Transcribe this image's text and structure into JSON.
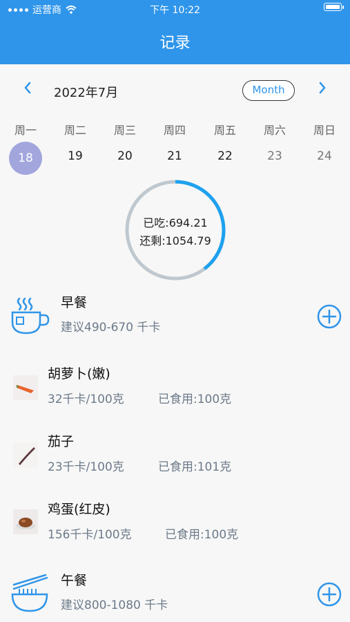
{
  "status_bar": {
    "carrier": "运营商",
    "time": "下午 10:22"
  },
  "header": {
    "title": "记录"
  },
  "calendar": {
    "month_label": "2022年7月",
    "view_toggle": "Month",
    "weekdays": [
      "周一",
      "周二",
      "周三",
      "周四",
      "周五",
      "周六",
      "周日"
    ],
    "dates": [
      "18",
      "19",
      "20",
      "21",
      "22",
      "23",
      "24"
    ],
    "selected_index": 0
  },
  "summary": {
    "eaten": "已吃:694.21",
    "remaining": "还剩:1054.79",
    "progress_fraction": 0.397,
    "colors": {
      "progress": "#1ea1ef",
      "track": "#bfc8cf"
    }
  },
  "meals": {
    "breakfast": {
      "title": "早餐",
      "suggestion": "建议490-670 千卡",
      "items": [
        {
          "name": "胡萝卜(嫩)",
          "calories": "32千卡/100克",
          "consumed": "已食用:100克"
        },
        {
          "name": "茄子",
          "calories": "23千卡/100克",
          "consumed": "已食用:101克"
        },
        {
          "name": "鸡蛋(红皮)",
          "calories": "156千卡/100克",
          "consumed": "已食用:100克"
        }
      ]
    },
    "lunch": {
      "title": "午餐",
      "suggestion": "建议800-1080 千卡"
    }
  },
  "colors": {
    "accent": "#2f95ea",
    "selected_date": "#a2a6dd"
  }
}
